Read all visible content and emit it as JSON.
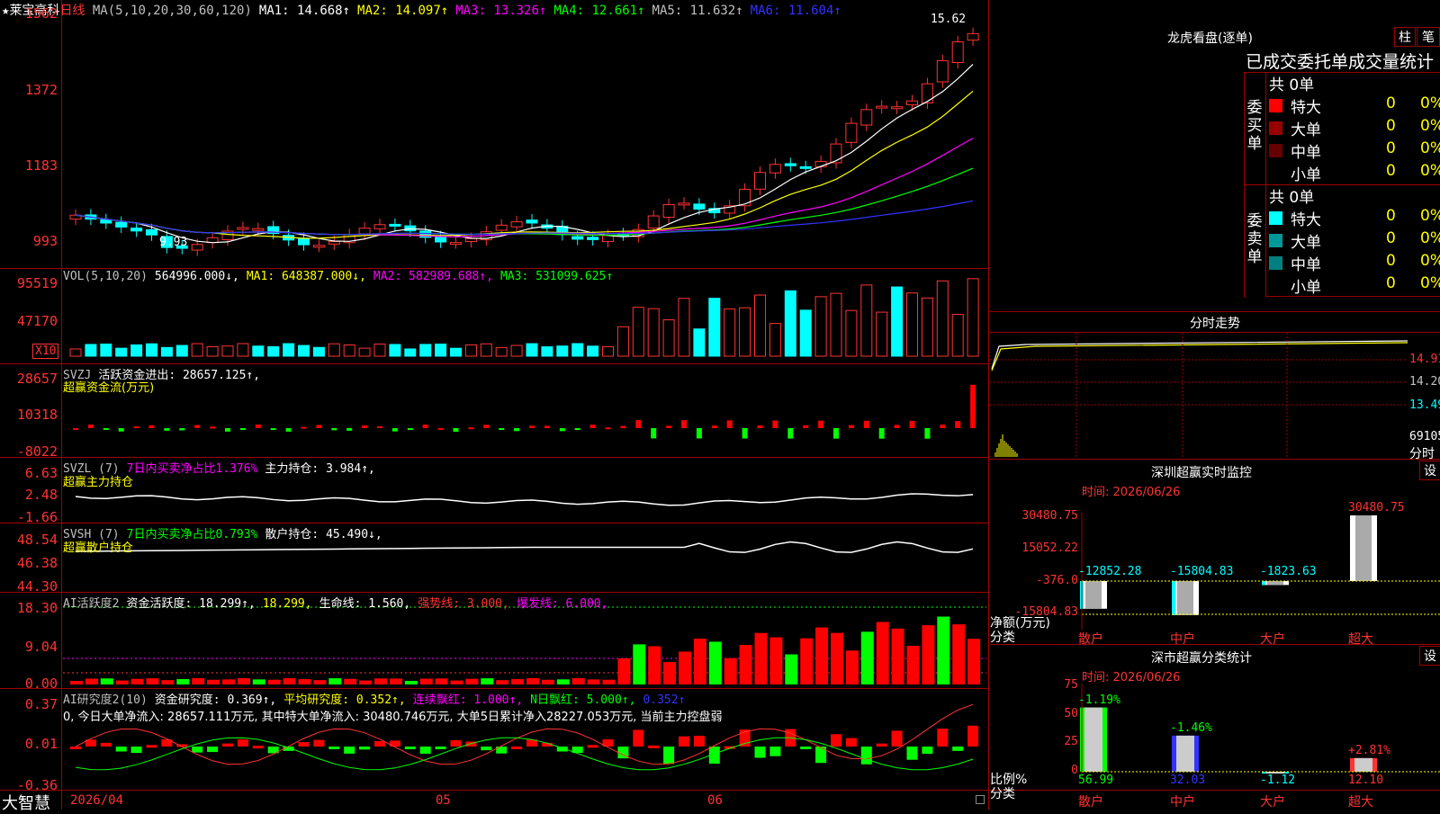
{
  "stock": {
    "name": "莱宝高科",
    "period": "日线",
    "star": "★"
  },
  "main": {
    "ma_line": [
      {
        "label": "MA(5,10,20,30,60,120)",
        "color": "#c0c0c0"
      },
      {
        "label": "MA1: 14.668↑",
        "color": "#ffffff"
      },
      {
        "label": "MA2: 14.097↑",
        "color": "#ffff00"
      },
      {
        "label": "MA3: 13.326↑",
        "color": "#ff00ff"
      },
      {
        "label": "MA4: 12.661↑",
        "color": "#00ff00"
      },
      {
        "label": "MA5: 11.632↑",
        "color": "#c0c0c0"
      },
      {
        "label": "MA6: 11.604↑",
        "color": "#3333ff"
      }
    ],
    "yticks": [
      "1562",
      "1372",
      "1183",
      "993"
    ],
    "high_label": "15.62",
    "low_label": "9.93"
  },
  "vol": {
    "labels": [
      {
        "t": "VOL(5,10,20)",
        "c": "#c0c0c0"
      },
      {
        "t": "564996.000↓,",
        "c": "#ffffff"
      },
      {
        "t": "MA1: 648387.000↓,",
        "c": "#ffff00"
      },
      {
        "t": "MA2: 582989.688↑,",
        "c": "#ff00ff"
      },
      {
        "t": "MA3: 531099.625↑",
        "c": "#00ff00"
      }
    ],
    "yticks": [
      "95519",
      "47170"
    ],
    "unit": "X10"
  },
  "svzj": {
    "line1": [
      {
        "t": "SVZJ",
        "c": "#c0c0c0"
      },
      {
        "t": "活跃资金进出: 28657.125↑,",
        "c": "#ffffff"
      }
    ],
    "line2": "超赢资金流(万元)",
    "yticks": [
      "28657",
      "10318",
      "-8022"
    ]
  },
  "svzl": {
    "line1": [
      {
        "t": "SVZL (7)",
        "c": "#c0c0c0"
      },
      {
        "t": "7日内买卖净占比1.376%",
        "c": "#ff00ff"
      },
      {
        "t": "主力持仓: 3.984↑,",
        "c": "#ffffff"
      }
    ],
    "line2": "超赢主力持仓",
    "yticks": [
      "6.63",
      "2.48",
      "-1.66"
    ]
  },
  "svsh": {
    "line1": [
      {
        "t": "SVSH (7)",
        "c": "#c0c0c0"
      },
      {
        "t": "7日内买卖净占比0.793%",
        "c": "#00ff00"
      },
      {
        "t": "散户持仓: 45.490↓,",
        "c": "#ffffff"
      }
    ],
    "line2": "超赢散户持仓",
    "yticks": [
      "48.54",
      "46.38",
      "44.30"
    ]
  },
  "ai1": {
    "line1": [
      {
        "t": "AI活跃度2",
        "c": "#c0c0c0"
      },
      {
        "t": "资金活跃度: 18.299↑,",
        "c": "#ffffff"
      },
      {
        "t": "18.299,",
        "c": "#ffff00"
      },
      {
        "t": "生命线: 1.560,",
        "c": "#ffffff"
      },
      {
        "t": "强势线: 3.000,",
        "c": "#ff3333"
      },
      {
        "t": "爆发线: 6.000,",
        "c": "#ff00ff"
      }
    ],
    "yticks": [
      "18.30",
      "9.04",
      "0.00"
    ]
  },
  "ai2": {
    "line1": [
      {
        "t": "AI研究度2(10)",
        "c": "#c0c0c0"
      },
      {
        "t": "资金研究度: 0.369↑,",
        "c": "#ffffff"
      },
      {
        "t": "平均研究度: 0.352↑,",
        "c": "#ffff00"
      },
      {
        "t": "连续飘红: 1.000↑,",
        "c": "#ff00ff"
      },
      {
        "t": "N日飘红: 5.000↑,",
        "c": "#00ff00"
      },
      {
        "t": "0.352↑",
        "c": "#3333ff"
      }
    ],
    "line2": "0, 今日大单净流入: 28657.111万元, 其中特大单净流入: 30480.746万元, 大单5日累计净入28227.053万元, 当前主力控盘弱",
    "yticks": [
      "0.37",
      "0.01",
      "-0.36"
    ]
  },
  "bottom": {
    "brand": "大智慧",
    "dates": [
      "2026/04",
      "05",
      "06"
    ]
  },
  "side": {
    "lhb_title": "龙虎看盘(逐单)",
    "tab_bar": "柱",
    "tab_detail": "笔",
    "order_title": "已成交委托单成交量统计",
    "buy_label": "委买单",
    "sell_label": "委卖单",
    "buy_total": "共 0单",
    "sell_total": "共 0单",
    "buy_rows": [
      {
        "name": "特大",
        "n": "0",
        "p": "0%",
        "color": "#ff0000"
      },
      {
        "name": "大单",
        "n": "0",
        "p": "0%",
        "color": "#990000"
      },
      {
        "name": "中单",
        "n": "0",
        "p": "0%",
        "color": "#660000"
      },
      {
        "name": "小单",
        "n": "0",
        "p": "0%",
        "color": "#000000"
      }
    ],
    "sell_rows": [
      {
        "name": "特大",
        "n": "0",
        "p": "0%",
        "color": "#00ffff"
      },
      {
        "name": "大单",
        "n": "0",
        "p": "0%",
        "color": "#009999"
      },
      {
        "name": "中单",
        "n": "0",
        "p": "0%",
        "color": "#008080"
      },
      {
        "name": "小单",
        "n": "0",
        "p": "0%",
        "color": "#000000"
      }
    ],
    "intraday_title": "分时走势",
    "intraday_ticks": [
      "14.91",
      "14.20",
      "13.49",
      "69105",
      "分时"
    ],
    "sz_title": "深圳超赢实时监控",
    "sz_time": "时间: 2026/06/26",
    "sz_set": "设",
    "sz_yticks": [
      "30480.75",
      "15052.22",
      "-376.0",
      "-15804.83"
    ],
    "sz_unit": "净额(万元)",
    "sz_cat": "分类",
    "sz_bars": [
      {
        "cat": "散户",
        "value": -12852.28,
        "label": "-12852.28"
      },
      {
        "cat": "中户",
        "value": -15804.83,
        "label": "-15804.83"
      },
      {
        "cat": "大户",
        "value": -1823.63,
        "label": "-1823.63"
      },
      {
        "cat": "超大",
        "value": 30480.75,
        "label": "30480.75"
      }
    ],
    "ss_title": "深市超赢分类统计",
    "ss_time": "时间: 2026/06/26",
    "ss_set": "设",
    "ss_yticks": [
      "75",
      "50",
      "25",
      "0"
    ],
    "ss_unit": "比例%",
    "ss_cat": "分类",
    "ss_bars": [
      {
        "cat": "散户",
        "value": 56.99,
        "label": "56.99",
        "chg": "-1.19%"
      },
      {
        "cat": "中户",
        "value": 32.03,
        "label": "32.03",
        "chg": "-1.46%"
      },
      {
        "cat": "大户",
        "value": -1.12,
        "label": "-1.12",
        "chg": ""
      },
      {
        "cat": "超大",
        "value": 12.1,
        "label": "12.10",
        "chg": "+2.81%"
      }
    ]
  }
}
